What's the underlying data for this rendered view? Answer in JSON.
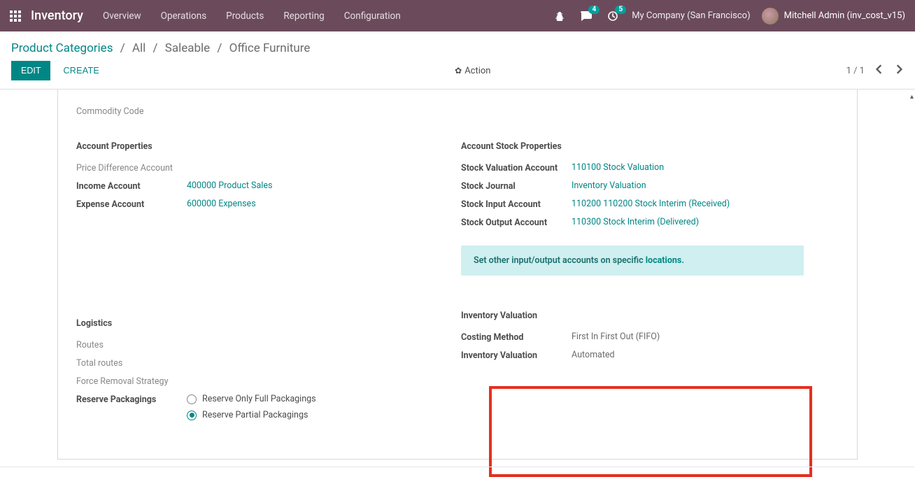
{
  "topbar": {
    "brand": "Inventory",
    "menu": [
      "Overview",
      "Operations",
      "Products",
      "Reporting",
      "Configuration"
    ],
    "chat_badge": "4",
    "activity_badge": "5",
    "company": "My Company (San Francisco)",
    "user": "Mitchell Admin (inv_cost_v15)"
  },
  "breadcrumb": {
    "root": "Product Categories",
    "seg1": "All",
    "seg2": "Saleable",
    "current": "Office Furniture"
  },
  "buttons": {
    "edit": "EDIT",
    "create": "CREATE",
    "action": "Action"
  },
  "pager": {
    "text": "1 / 1"
  },
  "fields": {
    "commodity_code_label": "Commodity Code",
    "account_props_title": "Account Properties",
    "price_diff_label": "Price Difference Account",
    "income_label": "Income Account",
    "income_value": "400000 Product Sales",
    "expense_label": "Expense Account",
    "expense_value": "600000 Expenses",
    "stock_props_title": "Account Stock Properties",
    "sva_label": "Stock Valuation Account",
    "sva_value": "110100 Stock Valuation",
    "sj_label": "Stock Journal",
    "sj_value": "Inventory Valuation",
    "sia_label": "Stock Input Account",
    "sia_value": "110200 110200 Stock Interim (Received)",
    "soa_label": "Stock Output Account",
    "soa_value": "110300 Stock Interim (Delivered)",
    "info_prefix": "Set other input/output accounts on specific ",
    "info_link": "locations",
    "info_suffix": ".",
    "logistics_title": "Logistics",
    "routes_label": "Routes",
    "total_routes_label": "Total routes",
    "force_removal_label": "Force Removal Strategy",
    "reserve_pack_label": "Reserve Packagings",
    "reserve_full": "Reserve Only Full Packagings",
    "reserve_partial": "Reserve Partial Packagings",
    "inv_val_title": "Inventory Valuation",
    "costing_label": "Costing Method",
    "costing_value": "First In First Out (FIFO)",
    "inv_val_label": "Inventory Valuation",
    "inv_val_value": "Automated"
  }
}
